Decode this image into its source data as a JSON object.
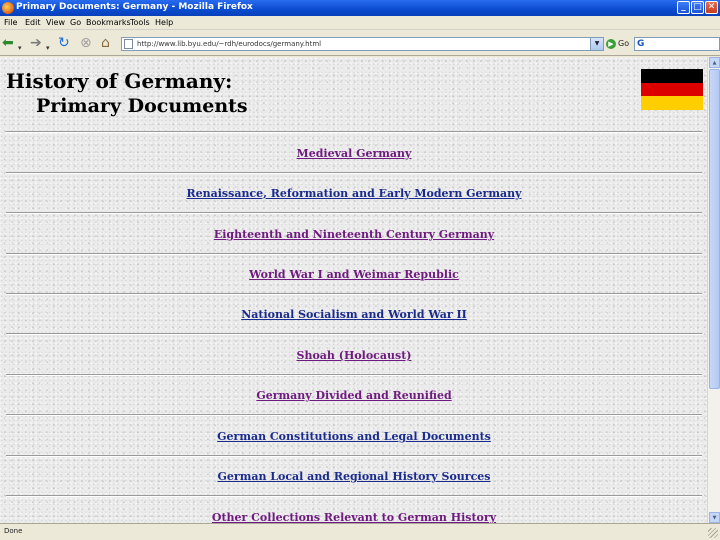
{
  "window": {
    "title": "Primary Documents: Germany - Mozilla Firefox",
    "controls": {
      "minimize": "_",
      "maximize": "□",
      "close": "✕"
    }
  },
  "menu": {
    "items": [
      "File",
      "Edit",
      "View",
      "Go",
      "Bookmarks",
      "Tools",
      "Help"
    ]
  },
  "toolbar": {
    "url": "http://www.lib.byu.edu/~rdh/eurodocs/germany.html",
    "go_label": "Go",
    "icons": [
      "back-icon",
      "forward-icon",
      "reload-icon",
      "stop-icon",
      "home-icon",
      "page-icon",
      "go-icon",
      "google-icon"
    ]
  },
  "page": {
    "heading_line1": "History of Germany:",
    "heading_line2": "Primary Documents",
    "flag_colors": [
      "#000000",
      "#dd0000",
      "#ffce00"
    ],
    "links": [
      {
        "label": "Medieval Germany",
        "visited": true
      },
      {
        "label": "Renaissance, Reformation and Early Modern Germany",
        "visited": false
      },
      {
        "label": "Eighteenth and Nineteenth Century Germany",
        "visited": true
      },
      {
        "label": "World War I and Weimar Republic",
        "visited": true
      },
      {
        "label": "National Socialism and World War II",
        "visited": false
      },
      {
        "label": "Shoah (Holocaust)",
        "visited": true
      },
      {
        "label": "Germany Divided and Reunified",
        "visited": true
      },
      {
        "label": "German Constitutions and Legal Documents",
        "visited": false
      },
      {
        "label": "German Local and Regional History Sources",
        "visited": false
      },
      {
        "label": "Other Collections Relevant to German History",
        "visited": true
      }
    ]
  },
  "status": {
    "text": "Done"
  }
}
